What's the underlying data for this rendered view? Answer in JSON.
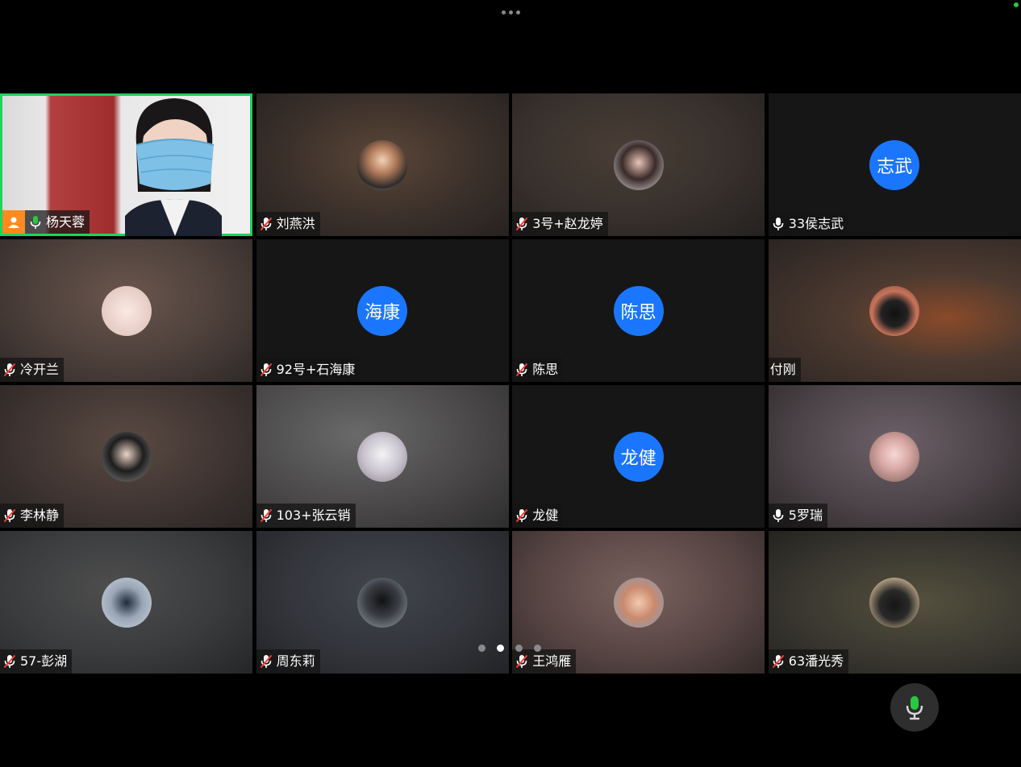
{
  "header": {
    "more_icon": "more-horizontal-icon"
  },
  "colors": {
    "active_speaker_border": "#1fd35b",
    "host_badge": "#ff8a1f",
    "initials_avatar": "#1a76ff",
    "mic_on": "#28c840",
    "mic_muted_slash": "#ff3b30"
  },
  "participants": [
    {
      "name": "杨天蓉",
      "mic": "on",
      "avatar": "self-video",
      "is_host": true,
      "is_active_speaker": true
    },
    {
      "name": "刘燕洪",
      "mic": "muted",
      "avatar": "photo"
    },
    {
      "name": "3号+赵龙婷",
      "mic": "muted",
      "avatar": "photo"
    },
    {
      "name": "33侯志武",
      "mic": "on",
      "avatar": "initials",
      "initials": "志武"
    },
    {
      "name": "冷开兰",
      "mic": "muted",
      "avatar": "photo"
    },
    {
      "name": "92号+石海康",
      "mic": "muted",
      "avatar": "initials",
      "initials": "海康"
    },
    {
      "name": "陈思",
      "mic": "muted",
      "avatar": "initials",
      "initials": "陈思"
    },
    {
      "name": "付刚",
      "mic": "none",
      "avatar": "photo"
    },
    {
      "name": "李林静",
      "mic": "muted",
      "avatar": "photo"
    },
    {
      "name": "103+张云销",
      "mic": "muted",
      "avatar": "photo"
    },
    {
      "name": "龙健",
      "mic": "muted",
      "avatar": "initials",
      "initials": "龙健"
    },
    {
      "name": "5罗瑞",
      "mic": "on",
      "avatar": "photo"
    },
    {
      "name": "57-彭湖",
      "mic": "muted",
      "avatar": "photo"
    },
    {
      "name": "周东莉",
      "mic": "muted",
      "avatar": "photo"
    },
    {
      "name": "王鸿雁",
      "mic": "muted",
      "avatar": "photo"
    },
    {
      "name": "63潘光秀",
      "mic": "muted",
      "avatar": "photo"
    }
  ],
  "pagination": {
    "pages": 4,
    "current_page": 2
  },
  "controls": {
    "mic_toggle_icon": "microphone-icon",
    "mic_state": "on"
  }
}
